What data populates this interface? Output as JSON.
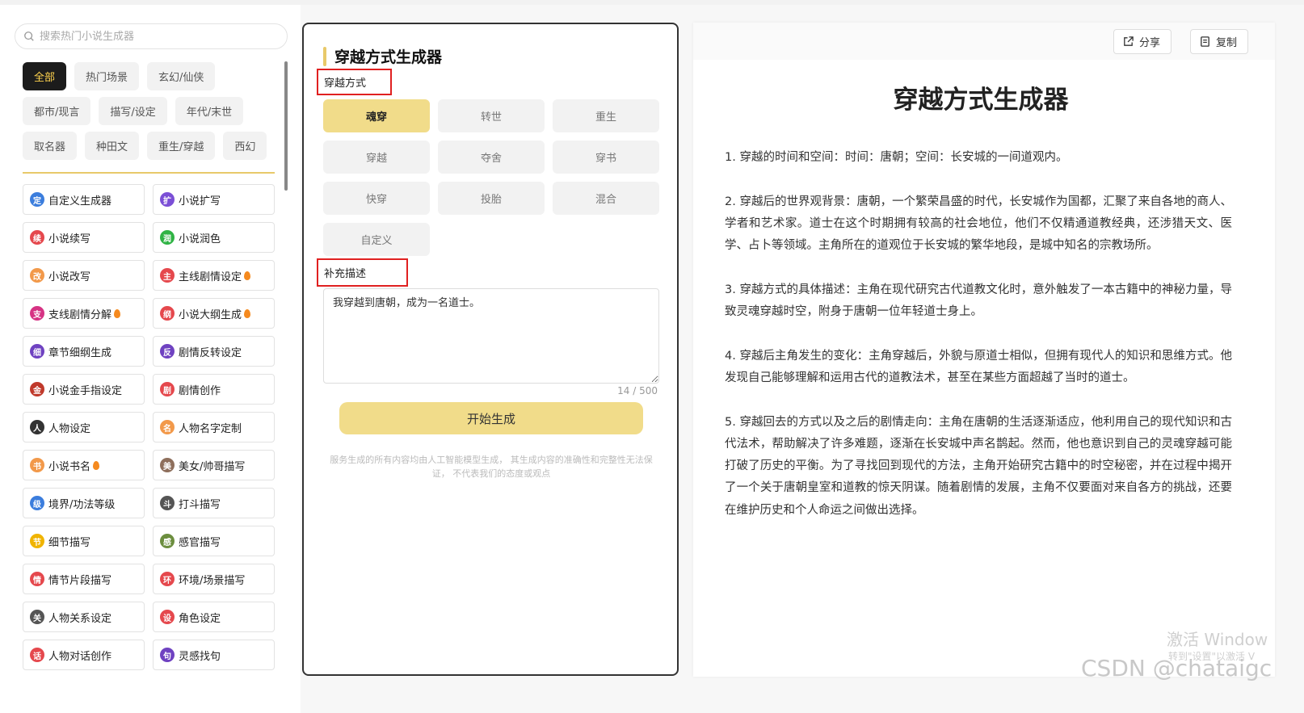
{
  "search": {
    "placeholder": "搜索热门小说生成器"
  },
  "tags": [
    "全部",
    "热门场景",
    "玄幻/仙侠",
    "都市/现言",
    "描写/设定",
    "年代/末世",
    "取名器",
    "种田文",
    "重生/穿越",
    "西幻"
  ],
  "tools": [
    {
      "label": "自定义生成器",
      "icon": "定",
      "color": "#3b7ddd",
      "hot": false
    },
    {
      "label": "小说扩写",
      "icon": "扩",
      "color": "#7b4fd6",
      "hot": false
    },
    {
      "label": "小说续写",
      "icon": "续",
      "color": "#e5484d",
      "hot": false
    },
    {
      "label": "小说润色",
      "icon": "润",
      "color": "#2fb344",
      "hot": false
    },
    {
      "label": "小说改写",
      "icon": "改",
      "color": "#f2994a",
      "hot": false
    },
    {
      "label": "主线剧情设定",
      "icon": "主",
      "color": "#e5484d",
      "hot": true
    },
    {
      "label": "支线剧情分解",
      "icon": "支",
      "color": "#d63384",
      "hot": true
    },
    {
      "label": "小说大纲生成",
      "icon": "纲",
      "color": "#e5484d",
      "hot": true
    },
    {
      "label": "章节细纲生成",
      "icon": "细",
      "color": "#6f42c1",
      "hot": false
    },
    {
      "label": "剧情反转设定",
      "icon": "反",
      "color": "#6f42c1",
      "hot": false
    },
    {
      "label": "小说金手指设定",
      "icon": "金",
      "color": "#c0392b",
      "hot": false
    },
    {
      "label": "剧情创作",
      "icon": "剧",
      "color": "#e5484d",
      "hot": false
    },
    {
      "label": "人物设定",
      "icon": "人",
      "color": "#333333",
      "hot": false
    },
    {
      "label": "人物名字定制",
      "icon": "名",
      "color": "#f2994a",
      "hot": false
    },
    {
      "label": "小说书名",
      "icon": "书",
      "color": "#f2994a",
      "hot": true
    },
    {
      "label": "美女/帅哥描写",
      "icon": "美",
      "color": "#8e6f5c",
      "hot": false
    },
    {
      "label": "境界/功法等级",
      "icon": "级",
      "color": "#3b7ddd",
      "hot": false
    },
    {
      "label": "打斗描写",
      "icon": "斗",
      "color": "#555555",
      "hot": false
    },
    {
      "label": "细节描写",
      "icon": "节",
      "color": "#f0b400",
      "hot": false
    },
    {
      "label": "感官描写",
      "icon": "感",
      "color": "#6c8e3f",
      "hot": false
    },
    {
      "label": "情节片段描写",
      "icon": "情",
      "color": "#e5484d",
      "hot": false
    },
    {
      "label": "环境/场景描写",
      "icon": "环",
      "color": "#e5484d",
      "hot": false
    },
    {
      "label": "人物关系设定",
      "icon": "关",
      "color": "#555555",
      "hot": false
    },
    {
      "label": "角色设定",
      "icon": "设",
      "color": "#e5484d",
      "hot": false
    },
    {
      "label": "人物对话创作",
      "icon": "话",
      "color": "#e5484d",
      "hot": false
    },
    {
      "label": "灵感找句",
      "icon": "句",
      "color": "#6f42c1",
      "hot": false
    }
  ],
  "generator": {
    "title": "穿越方式生成器",
    "method_label": "穿越方式",
    "methods": [
      "魂穿",
      "转世",
      "重生",
      "穿越",
      "夺舍",
      "穿书",
      "快穿",
      "投胎",
      "混合",
      "自定义"
    ],
    "active_method": "魂穿",
    "desc_label": "补充描述",
    "desc_value": "我穿越到唐朝，成为一名道士。",
    "counter": "14 / 500",
    "generate_label": "开始生成",
    "disclaimer": "服务生成的所有内容均由人工智能模型生成， 其生成内容的准确性和完整性无法保证， 不代表我们的态度或观点"
  },
  "result": {
    "share_label": "分享",
    "copy_label": "复制",
    "title": "穿越方式生成器",
    "paragraphs": [
      "1. 穿越的时间和空间：时间：唐朝；空间：长安城的一间道观内。",
      "2. 穿越后的世界观背景：唐朝，一个繁荣昌盛的时代，长安城作为国都，汇聚了来自各地的商人、学者和艺术家。道士在这个时期拥有较高的社会地位，他们不仅精通道教经典，还涉猎天文、医学、占卜等领域。主角所在的道观位于长安城的繁华地段，是城中知名的宗教场所。",
      "3. 穿越方式的具体描述：主角在现代研究古代道教文化时，意外触发了一本古籍中的神秘力量，导致灵魂穿越时空，附身于唐朝一位年轻道士身上。",
      "4. 穿越后主角发生的变化：主角穿越后，外貌与原道士相似，但拥有现代人的知识和思维方式。他发现自己能够理解和运用古代的道教法术，甚至在某些方面超越了当时的道士。",
      "5. 穿越回去的方式以及之后的剧情走向：主角在唐朝的生活逐渐适应，他利用自己的现代知识和古代法术，帮助解决了许多难题，逐渐在长安城中声名鹊起。然而，他也意识到自己的灵魂穿越可能打破了历史的平衡。为了寻找回到现代的方法，主角开始研究古籍中的时空秘密，并在过程中揭开了一个关于唐朝皇室和道教的惊天阴谋。随着剧情的发展，主角不仅要面对来自各方的挑战，还要在维护历史和个人命运之间做出选择。"
    ]
  },
  "watermarks": {
    "activate": "激活 Window",
    "activate_sub": "转到\"设置\"以激活 V",
    "csdn": "CSDN @chataigc"
  }
}
